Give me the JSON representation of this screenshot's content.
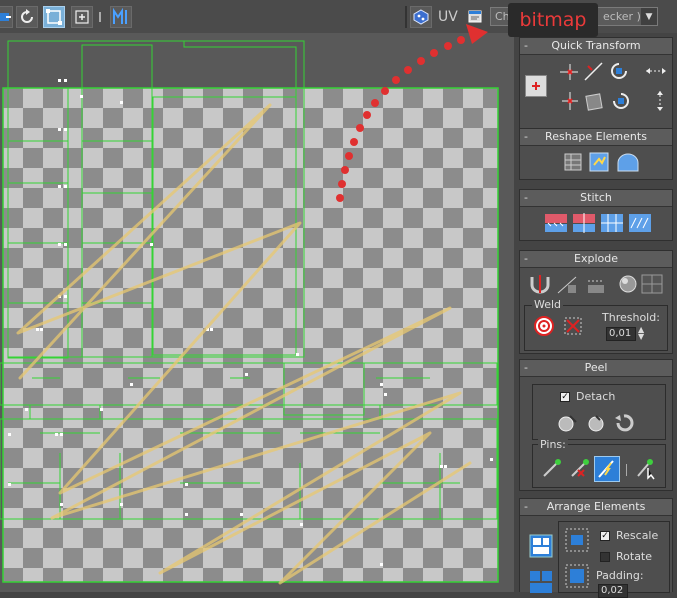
{
  "toolbar": {
    "uv_label": "UV",
    "texture_select_value": "Checker ( Checker )",
    "texture_select_visible_left": "Chec",
    "texture_select_visible_right": "ecker )",
    "icons": [
      "freeform-icon",
      "rotate-icon",
      "scale-icon",
      "move-icon",
      "mirror-icon",
      "texture-icon",
      "texture-select-icon"
    ]
  },
  "tooltip": {
    "text": "bitmap",
    "color": "#ea3a3a"
  },
  "panel": {
    "quick_transform": {
      "title": "Quick Transform"
    },
    "reshape_elements": {
      "title": "Reshape Elements"
    },
    "stitch": {
      "title": "Stitch"
    },
    "explode": {
      "title": "Explode",
      "weld_label": "Weld",
      "threshold_label": "Threshold:",
      "threshold_value": "0,01"
    },
    "peel": {
      "title": "Peel",
      "detach_label": "Detach",
      "detach_checked": true,
      "pins_label": "Pins:"
    },
    "arrange_elements": {
      "title": "Arrange Elements",
      "rescale_label": "Rescale",
      "rescale_checked": true,
      "rotate_label": "Rotate",
      "rotate_checked": false,
      "padding_label": "Padding:",
      "padding_value": "0,02"
    }
  },
  "colors": {
    "uv_edge": "#35d335",
    "checker_light": "#c8c8c8",
    "checker_dark": "#8c8c8c",
    "annotation": "#e8c870",
    "accent": "#2d7fd8"
  }
}
